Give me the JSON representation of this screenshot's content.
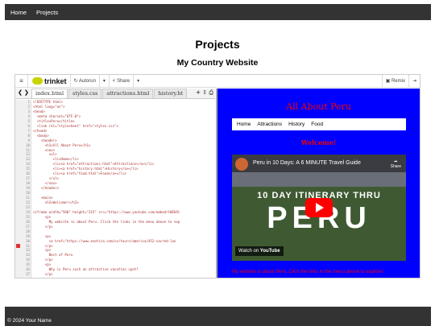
{
  "nav": {
    "items": [
      "Home",
      "Projects"
    ]
  },
  "page": {
    "title": "Projects",
    "subtitle": "My Country Website"
  },
  "trinket": {
    "logo": "trinket",
    "autorun": "Autorun",
    "share": "Share",
    "remix": "Remix",
    "tabs": [
      "index.html",
      "styles.css",
      "attractions.html",
      "history.ht"
    ],
    "accent": "#c8d400"
  },
  "editor": {
    "lines": [
      "<!DOCTYPE html>",
      "<html lang=\"en\">",
      "<head>",
      "  <meta charset=\"UTF-8\">",
      "  <title>Peru</title>",
      "  <link rel=\"stylesheet\" href=\"styles.css\">",
      "</head>",
      "  <body>",
      "    <header>",
      "      <h1>All About Peru</h1>",
      "      <nav>",
      "        <ul>",
      "          <li>Home</li>",
      "          <li><a href=\"attractions.html\">Attractions</a></li>",
      "          <li><a href=\"history.html\">History</a></li>",
      "          <li><a href=\"food.html\">Food</a></li>",
      "        </ul>",
      "      </nav>",
      "    </header>",
      "",
      "    <main>",
      "      <h2>Welcome!</h2>",
      "",
      "<iframe width=\"560\" height=\"315\" src=\"https://www.youtube.com/embed/tWEKAl",
      "      <p>",
      "        My website is about Peru. Click the links in the menu above to exp",
      "      </p>",
      "",
      "      <p>",
      "        <a href=\"https://www.exotica.com/us/tours/america/452-sacred-lan",
      "      </p>",
      "      <p>",
      "        Best of Peru",
      "      </p>",
      "      <p>",
      "        Why is Peru such an attractive vacation spot?",
      "      </p>"
    ],
    "error_line": 31
  },
  "output": {
    "heading": "All About Peru",
    "nav": [
      "Home",
      "Attractions",
      "History",
      "Food"
    ],
    "welcome": "Welcome!",
    "video_title": "Peru in 10 Days: A 6 MINUTE Travel Guide",
    "video_share": "Share",
    "video_band": "10 DAY ITINERARY THRU",
    "video_big": "PERU",
    "video_watch": "Watch on",
    "video_youtube": "YouTube",
    "paragraph": "My website is about Peru. Click the links in the menu above to explore!",
    "bg_color": "#0000ff",
    "text_color": "#ee0000"
  },
  "footer": {
    "text": "© 2024 Your Name"
  }
}
